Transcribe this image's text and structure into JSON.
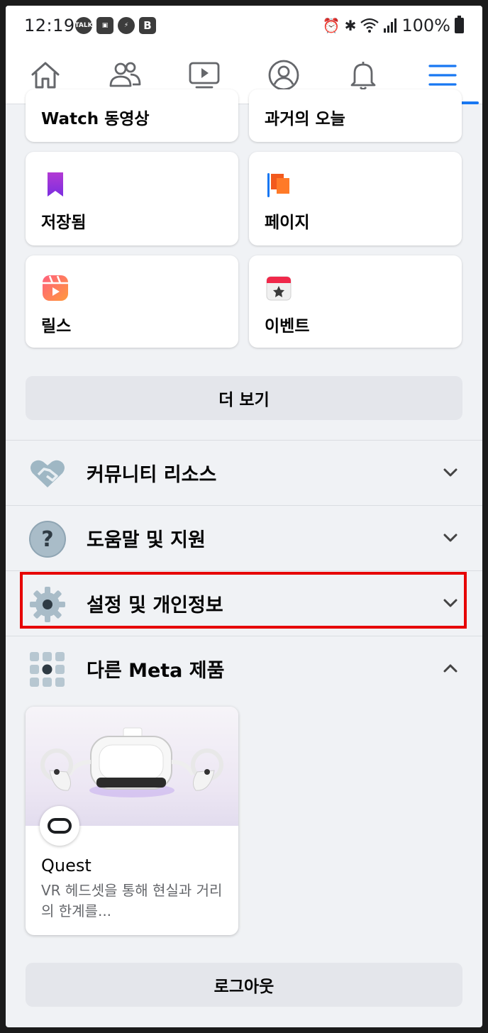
{
  "status_bar": {
    "time": "12:19",
    "left_icons": [
      "kakaotalk-icon",
      "gallery-icon",
      "power-icon",
      "b-app-icon"
    ],
    "talk_text": "TALK",
    "b_text": "B",
    "right_icons": [
      "alarm-icon",
      "bluetooth-icon",
      "wifi-icon",
      "signal-icon"
    ],
    "battery": "100%"
  },
  "nav": {
    "items": [
      "home",
      "friends",
      "watch",
      "profile",
      "notifications",
      "menu"
    ],
    "active": "menu",
    "accent": "#1877f2"
  },
  "shortcuts": [
    {
      "label": "Watch 동영상"
    },
    {
      "label": "과거의 오늘"
    },
    {
      "label": "저장됨",
      "icon": "bookmark-icon"
    },
    {
      "label": "페이지",
      "icon": "flag-icon"
    },
    {
      "label": "릴스",
      "icon": "reels-icon"
    },
    {
      "label": "이벤트",
      "icon": "calendar-star-icon"
    }
  ],
  "see_more": "더 보기",
  "sections": [
    {
      "label": "커뮤니티 리소스",
      "icon": "handshake-icon",
      "expanded": false
    },
    {
      "label": "도움말 및 지원",
      "icon": "question-icon",
      "expanded": false
    },
    {
      "label": "설정 및 개인정보",
      "icon": "gear-icon",
      "expanded": false,
      "highlighted": true
    },
    {
      "label": "다른 Meta 제품",
      "icon": "grid-icon",
      "expanded": true
    }
  ],
  "meta_products": [
    {
      "title": "Quest",
      "description": "VR 헤드셋을 통해 현실과 거리의 한계를...",
      "icon": "quest-logo-icon"
    }
  ],
  "logout": "로그아웃",
  "highlight_color": "#e60000"
}
